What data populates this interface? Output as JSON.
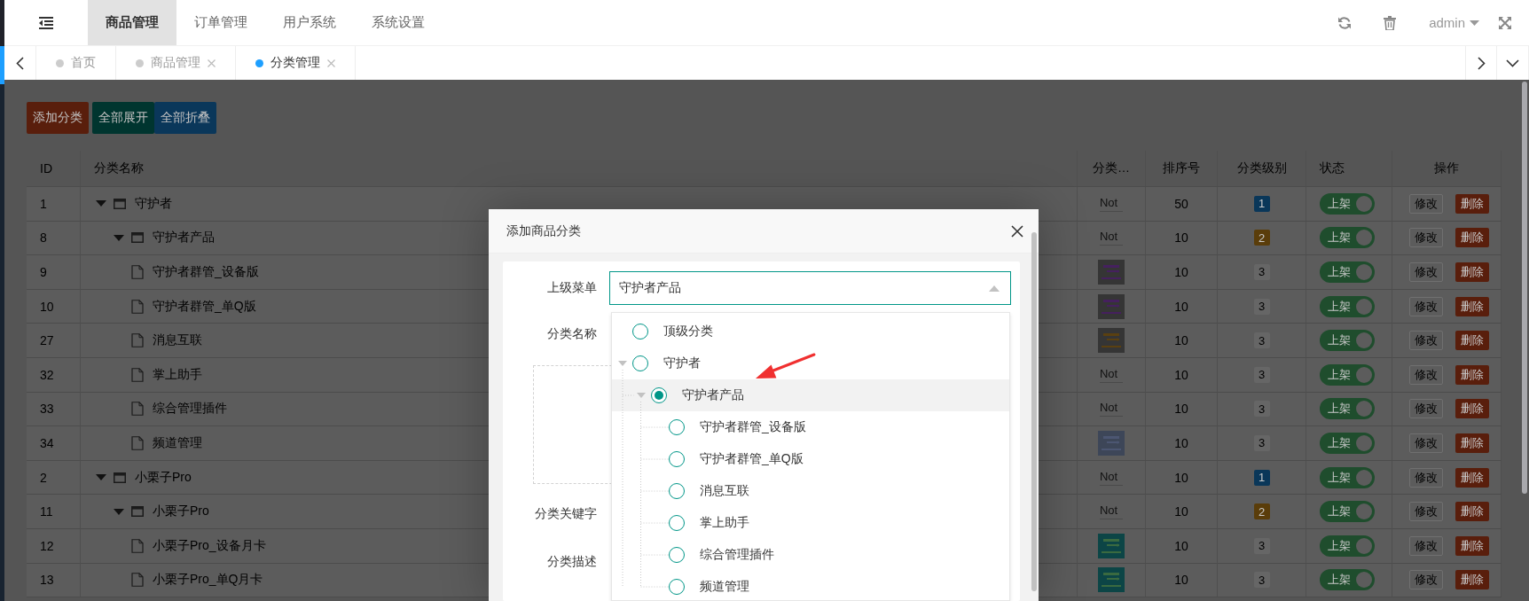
{
  "header": {
    "nav": [
      {
        "label": "商品管理",
        "selected": true
      },
      {
        "label": "订单管理",
        "selected": false
      },
      {
        "label": "用户系统",
        "selected": false
      },
      {
        "label": "系统设置",
        "selected": false
      }
    ],
    "user": "admin"
  },
  "tabs": [
    {
      "label": "首页",
      "selected": false,
      "closable": false
    },
    {
      "label": "商品管理",
      "selected": false,
      "closable": true
    },
    {
      "label": "分类管理",
      "selected": true,
      "closable": true
    }
  ],
  "toolbar": [
    {
      "label": "添加分类",
      "kind": "danger"
    },
    {
      "label": "全部展开",
      "kind": "success"
    },
    {
      "label": "全部折叠",
      "kind": "primary"
    }
  ],
  "table": {
    "columns": [
      "ID",
      "分类名称",
      "分类…",
      "排序号",
      "分类级别",
      "状态",
      "操作"
    ],
    "rows": [
      {
        "id": "1",
        "name": "守护者",
        "expanded": true,
        "thumb": {
          "kind": "missing",
          "text": "Not"
        },
        "sort": "50",
        "level": {
          "text": "1",
          "color": "#0a3759"
        },
        "status": {
          "label": "上架",
          "on": true
        },
        "edit": "修改",
        "delete": "删除",
        "children": [
          {
            "id": "8",
            "name": "守护者产品",
            "expanded": true,
            "thumb": {
              "kind": "missing",
              "text": "Not"
            },
            "sort": "10",
            "level": {
              "text": "2",
              "color": "#5a3d0a"
            },
            "status": {
              "label": "上架",
              "on": true
            },
            "edit": "修改",
            "delete": "删除",
            "children": [
              {
                "id": "9",
                "name": "守护者群管_设备版",
                "sort": "10",
                "level": {
                  "text": "3",
                  "color": "#666666"
                },
                "status": {
                  "label": "上架",
                  "on": true
                },
                "edit": "修改",
                "delete": "删除"
              },
              {
                "id": "10",
                "name": "守护者群管_单Q版",
                "sort": "10",
                "level": {
                  "text": "3",
                  "color": "#666666"
                },
                "status": {
                  "label": "上架",
                  "on": true
                },
                "edit": "修改",
                "delete": "删除"
              },
              {
                "id": "27",
                "name": "消息互联",
                "sort": "10",
                "level": {
                  "text": "3",
                  "color": "#666666"
                },
                "status": {
                  "label": "上架",
                  "on": true
                },
                "edit": "修改",
                "delete": "删除"
              },
              {
                "id": "32",
                "name": "掌上助手",
                "thumb": {
                  "kind": "missing",
                  "text": "Not"
                },
                "sort": "10",
                "level": {
                  "text": "3",
                  "color": "#666666"
                },
                "status": {
                  "label": "上架",
                  "on": true
                },
                "edit": "修改",
                "delete": "删除"
              },
              {
                "id": "33",
                "name": "综合管理插件",
                "thumb": {
                  "kind": "missing",
                  "text": "Not"
                },
                "sort": "10",
                "level": {
                  "text": "3",
                  "color": "#666666"
                },
                "status": {
                  "label": "上架",
                  "on": true
                },
                "edit": "修改",
                "delete": "删除"
              },
              {
                "id": "34",
                "name": "频道管理",
                "sort": "10",
                "level": {
                  "text": "3",
                  "color": "#666666"
                },
                "status": {
                  "label": "上架",
                  "on": true
                },
                "edit": "修改",
                "delete": "删除"
              }
            ]
          }
        ]
      },
      {
        "id": "2",
        "name": "小栗子Pro",
        "expanded": true,
        "thumb": {
          "kind": "missing",
          "text": "Not"
        },
        "sort": "10",
        "level": {
          "text": "1",
          "color": "#0a3759"
        },
        "status": {
          "label": "上架",
          "on": true
        },
        "edit": "修改",
        "delete": "删除",
        "children": [
          {
            "id": "11",
            "name": "小栗子Pro",
            "expanded": true,
            "thumb": {
              "kind": "missing",
              "text": "Not"
            },
            "sort": "10",
            "level": {
              "text": "2",
              "color": "#5a3d0a"
            },
            "status": {
              "label": "上架",
              "on": true
            },
            "edit": "修改",
            "delete": "删除",
            "children": [
              {
                "id": "12",
                "name": "小栗子Pro_设备月卡",
                "sort": "10",
                "level": {
                  "text": "3",
                  "color": "#666666"
                },
                "status": {
                  "label": "上架",
                  "on": true
                },
                "edit": "修改",
                "delete": "删除"
              },
              {
                "id": "13",
                "name": "小栗子Pro_单Q月卡",
                "sort": "10",
                "level": {
                  "text": "3",
                  "color": "#666666"
                },
                "status": {
                  "label": "上架",
                  "on": true
                },
                "edit": "修改",
                "delete": "删除"
              }
            ]
          }
        ]
      }
    ]
  },
  "dialog": {
    "title": "添加商品分类",
    "fields": [
      {
        "kind": "select",
        "label": "上级菜单",
        "value": "守护者产品",
        "open": true,
        "options": [
          {
            "label": "顶级分类",
            "selected": false
          },
          {
            "label": "守护者",
            "selected": false,
            "expanded": true,
            "children": [
              {
                "label": "守护者产品",
                "selected": true,
                "expanded": true,
                "children": [
                  {
                    "label": "守护者群管_设备版",
                    "selected": false
                  },
                  {
                    "label": "守护者群管_单Q版",
                    "selected": false
                  },
                  {
                    "label": "消息互联",
                    "selected": false
                  },
                  {
                    "label": "掌上助手",
                    "selected": false
                  },
                  {
                    "label": "综合管理插件",
                    "selected": false
                  },
                  {
                    "label": "频道管理",
                    "selected": false
                  }
                ]
              }
            ]
          }
        ]
      },
      {
        "kind": "text",
        "label": "分类名称"
      },
      {
        "kind": "upload"
      },
      {
        "kind": "text",
        "label": "分类关键字"
      },
      {
        "kind": "text",
        "label": "分类描述"
      }
    ]
  }
}
